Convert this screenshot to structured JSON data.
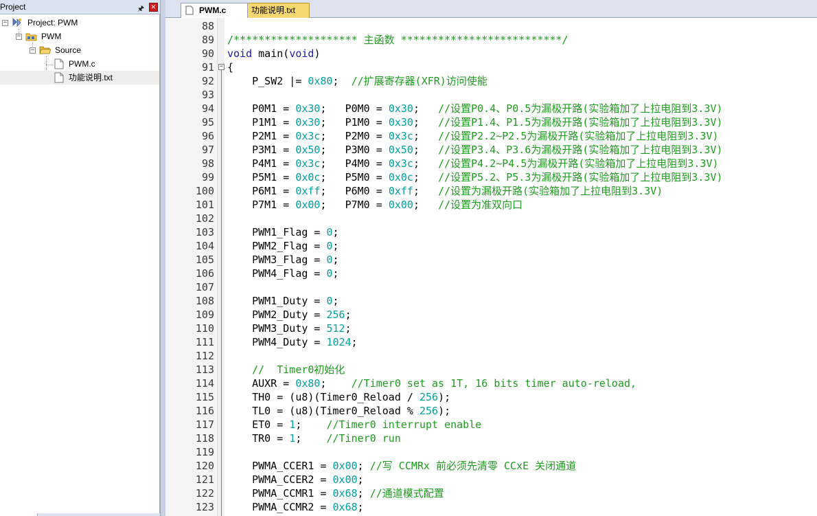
{
  "project_panel": {
    "title": "Project",
    "pin_icon": "pin-icon",
    "close_icon": "close-icon",
    "tree": {
      "project": "Project: PWM",
      "target": "PWM",
      "group": "Source",
      "files": [
        "PWM.c",
        "功能说明.txt"
      ]
    }
  },
  "tabs": [
    {
      "label": "PWM.c",
      "active": true
    },
    {
      "label": "功能说明.txt",
      "active": false
    }
  ],
  "editor": {
    "lines": [
      {
        "n": "88",
        "code": ""
      },
      {
        "n": "89",
        "code": "/******************** 主函数 **************************/",
        "type": "comment"
      },
      {
        "n": "90",
        "code": "void main(void)"
      },
      {
        "n": "91",
        "code": "{",
        "fold": true
      },
      {
        "n": "92",
        "code": "    P_SW2 |= 0x80;  //扩展寄存器(XFR)访问使能"
      },
      {
        "n": "93",
        "code": ""
      },
      {
        "n": "94",
        "code": "    P0M1 = 0x30;   P0M0 = 0x30;   //设置P0.4、P0.5为漏极开路(实验箱加了上拉电阻到3.3V)"
      },
      {
        "n": "95",
        "code": "    P1M1 = 0x30;   P1M0 = 0x30;   //设置P1.4、P1.5为漏极开路(实验箱加了上拉电阻到3.3V)"
      },
      {
        "n": "96",
        "code": "    P2M1 = 0x3c;   P2M0 = 0x3c;   //设置P2.2~P2.5为漏极开路(实验箱加了上拉电阻到3.3V)"
      },
      {
        "n": "97",
        "code": "    P3M1 = 0x50;   P3M0 = 0x50;   //设置P3.4、P3.6为漏极开路(实验箱加了上拉电阻到3.3V)"
      },
      {
        "n": "98",
        "code": "    P4M1 = 0x3c;   P4M0 = 0x3c;   //设置P4.2~P4.5为漏极开路(实验箱加了上拉电阻到3.3V)"
      },
      {
        "n": "99",
        "code": "    P5M1 = 0x0c;   P5M0 = 0x0c;   //设置P5.2、P5.3为漏极开路(实验箱加了上拉电阻到3.3V)"
      },
      {
        "n": "100",
        "code": "    P6M1 = 0xff;   P6M0 = 0xff;   //设置为漏极开路(实验箱加了上拉电阻到3.3V)"
      },
      {
        "n": "101",
        "code": "    P7M1 = 0x00;   P7M0 = 0x00;   //设置为准双向口"
      },
      {
        "n": "102",
        "code": ""
      },
      {
        "n": "103",
        "code": "    PWM1_Flag = 0;"
      },
      {
        "n": "104",
        "code": "    PWM2_Flag = 0;"
      },
      {
        "n": "105",
        "code": "    PWM3_Flag = 0;"
      },
      {
        "n": "106",
        "code": "    PWM4_Flag = 0;"
      },
      {
        "n": "107",
        "code": ""
      },
      {
        "n": "108",
        "code": "    PWM1_Duty = 0;"
      },
      {
        "n": "109",
        "code": "    PWM2_Duty = 256;"
      },
      {
        "n": "110",
        "code": "    PWM3_Duty = 512;"
      },
      {
        "n": "111",
        "code": "    PWM4_Duty = 1024;"
      },
      {
        "n": "112",
        "code": ""
      },
      {
        "n": "113",
        "code": "    //  Timer0初始化"
      },
      {
        "n": "114",
        "code": "    AUXR = 0x80;    //Timer0 set as 1T, 16 bits timer auto-reload,"
      },
      {
        "n": "115",
        "code": "    TH0 = (u8)(Timer0_Reload / 256);"
      },
      {
        "n": "116",
        "code": "    TL0 = (u8)(Timer0_Reload % 256);"
      },
      {
        "n": "117",
        "code": "    ET0 = 1;    //Timer0 interrupt enable"
      },
      {
        "n": "118",
        "code": "    TR0 = 1;    //Tiner0 run"
      },
      {
        "n": "119",
        "code": ""
      },
      {
        "n": "120",
        "code": "    PWMA_CCER1 = 0x00; //写 CCMRx 前必须先清零 CCxE 关闭通道"
      },
      {
        "n": "121",
        "code": "    PWMA_CCER2 = 0x00;"
      },
      {
        "n": "122",
        "code": "    PWMA_CCMR1 = 0x68; //通道模式配置"
      },
      {
        "n": "123",
        "code": "    PWMA_CCMR2 = 0x68;"
      }
    ]
  },
  "colors": {
    "comment": "#1e9c1e",
    "keyword": "#1a1ab0",
    "number": "#00a0a0",
    "active_tab_bg": "#ffffff",
    "inactive_tab_bg": "#f7d86e"
  }
}
